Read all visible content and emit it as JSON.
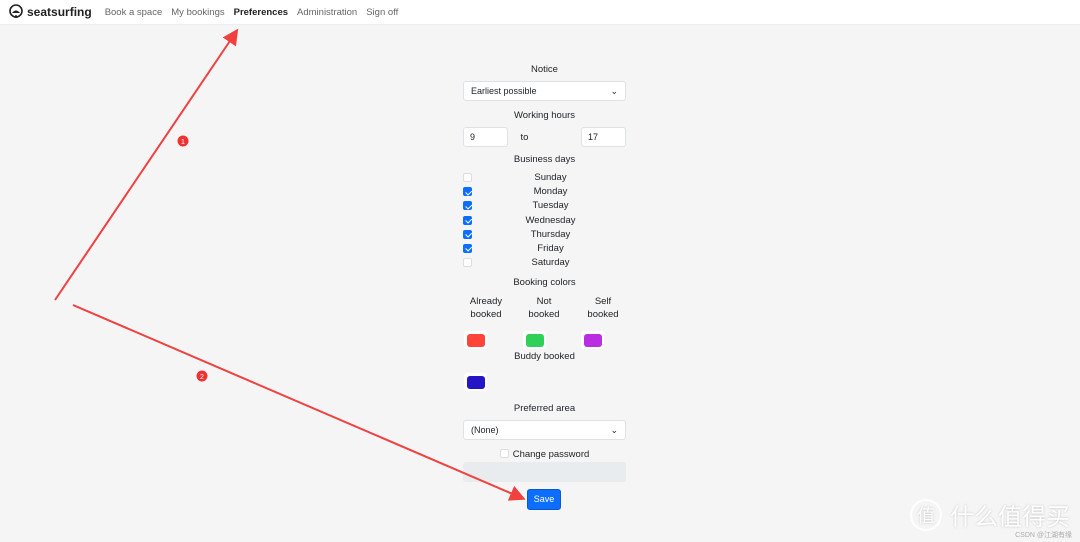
{
  "nav": {
    "brand": "seatsurfing",
    "items": [
      {
        "label": "Book a space"
      },
      {
        "label": "My bookings"
      },
      {
        "label": "Preferences",
        "active": true
      },
      {
        "label": "Administration"
      },
      {
        "label": "Sign off"
      }
    ]
  },
  "form": {
    "notice_label": "Notice",
    "notice_value": "Earliest possible",
    "working_hours_label": "Working hours",
    "hours_from": "9",
    "hours_to_label": "to",
    "hours_to": "17",
    "business_days_label": "Business days",
    "days": [
      {
        "label": "Sunday",
        "checked": false
      },
      {
        "label": "Monday",
        "checked": true
      },
      {
        "label": "Tuesday",
        "checked": true
      },
      {
        "label": "Wednesday",
        "checked": true
      },
      {
        "label": "Thursday",
        "checked": true
      },
      {
        "label": "Friday",
        "checked": true
      },
      {
        "label": "Saturday",
        "checked": false
      }
    ],
    "booking_colors_label": "Booking colors",
    "colors": {
      "already_booked": {
        "label1": "Already",
        "label2": "booked",
        "color": "#ff453a"
      },
      "not_booked": {
        "label1": "Not",
        "label2": "booked",
        "color": "#30d158"
      },
      "self_booked": {
        "label1": "Self",
        "label2": "booked",
        "color": "#b82ee0"
      },
      "buddy_booked": {
        "label": "Buddy booked",
        "color": "#2415c5"
      }
    },
    "preferred_area_label": "Preferred area",
    "preferred_area_value": "(None)",
    "change_password_label": "Change password",
    "save_label": "Save"
  },
  "annotations": {
    "color": "#f04040",
    "markers": [
      "1",
      "2"
    ]
  },
  "watermark": {
    "logo": "值",
    "text": "什么值得买",
    "credit": "CSDN @江湖有缘"
  }
}
